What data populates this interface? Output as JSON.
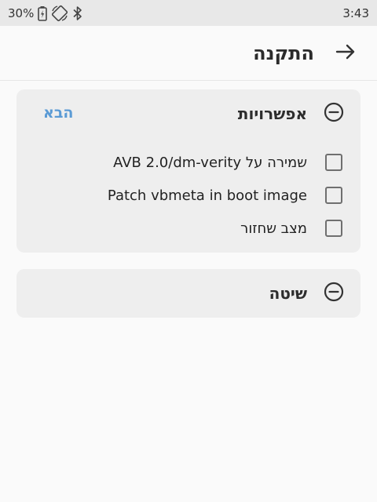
{
  "status": {
    "battery": "30%",
    "time": "3:43"
  },
  "appbar": {
    "title": "התקנה"
  },
  "options_card": {
    "title": "אפשרויות",
    "next_label": "הבא",
    "items": [
      {
        "label": "שמירה על AVB 2.0/dm-verity",
        "checked": false
      },
      {
        "label": "Patch vbmeta in boot image",
        "checked": false
      },
      {
        "label": "מצב שחזור",
        "checked": false
      }
    ]
  },
  "method_card": {
    "title": "שיטה"
  },
  "colors": {
    "accent": "#5b9bd5",
    "card_bg": "#eeeeee",
    "page_bg": "#fafafa",
    "statusbar_bg": "#e8e8e8"
  },
  "icons": {
    "back": "arrow-right-icon",
    "collapse": "minus-circle-icon",
    "battery": "battery-charging-icon",
    "rotate": "auto-rotate-icon",
    "bluetooth": "bluetooth-icon"
  }
}
